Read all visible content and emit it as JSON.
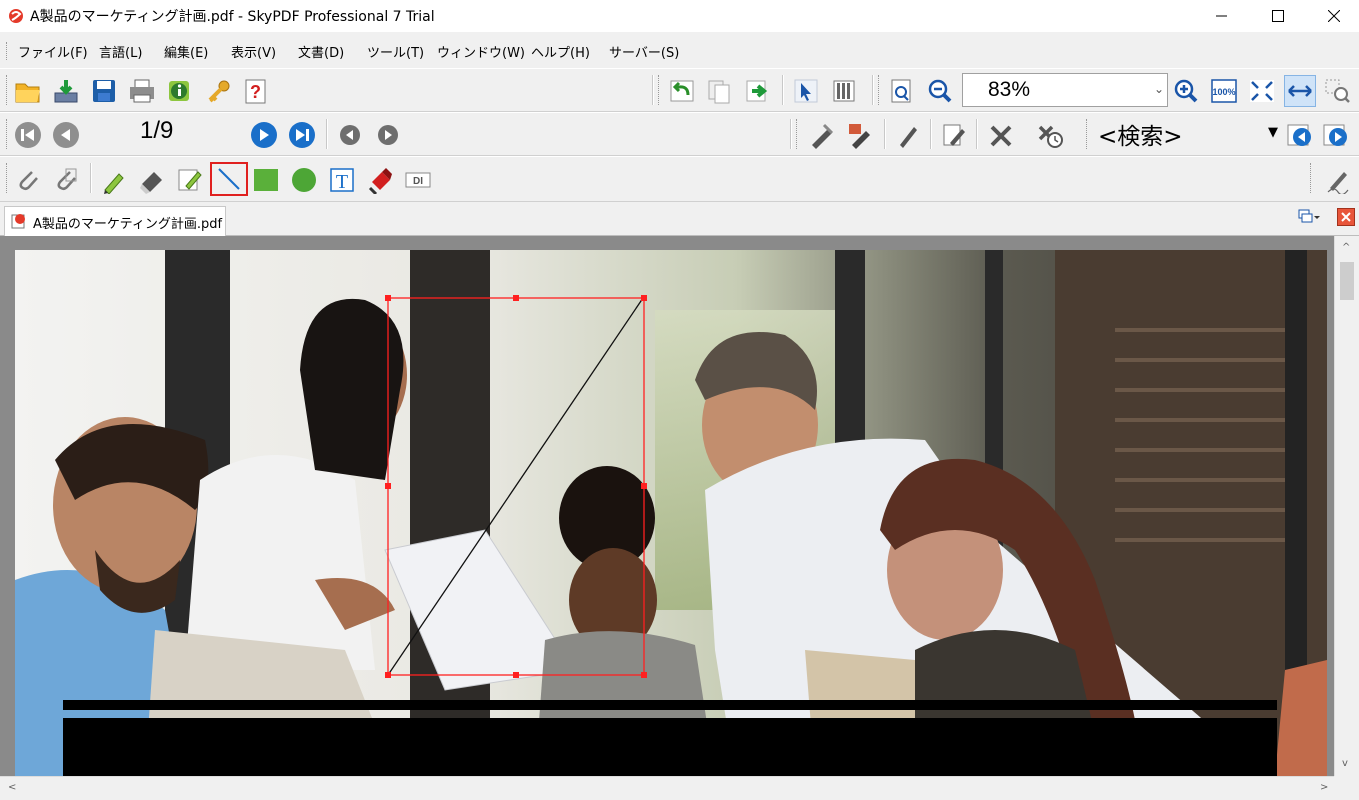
{
  "window": {
    "title": "A製品のマーケティング計画.pdf - SkyPDF Professional 7 Trial",
    "minimize_glyph": "—",
    "maximize_glyph": "☐",
    "close_glyph": "✕"
  },
  "menu": {
    "items": [
      {
        "label": "ファイル(F)"
      },
      {
        "label": "言語(L)"
      },
      {
        "label": "編集(E)"
      },
      {
        "label": "表示(V)"
      },
      {
        "label": "文書(D)"
      },
      {
        "label": "ツール(T)"
      },
      {
        "label": "ウィンドウ(W)"
      },
      {
        "label": "ヘルプ(H)"
      },
      {
        "label": "サーバー(S)"
      }
    ]
  },
  "toolbar": {
    "zoom": "83%",
    "page_indicator": "1/9",
    "search_label": "<検索>"
  },
  "tab": {
    "label": "A製品のマーケティング計画.pdf"
  },
  "colors": {
    "highlight": "#e0201f",
    "accent_blue": "#1a6fc9",
    "selection": "#ff2020"
  }
}
